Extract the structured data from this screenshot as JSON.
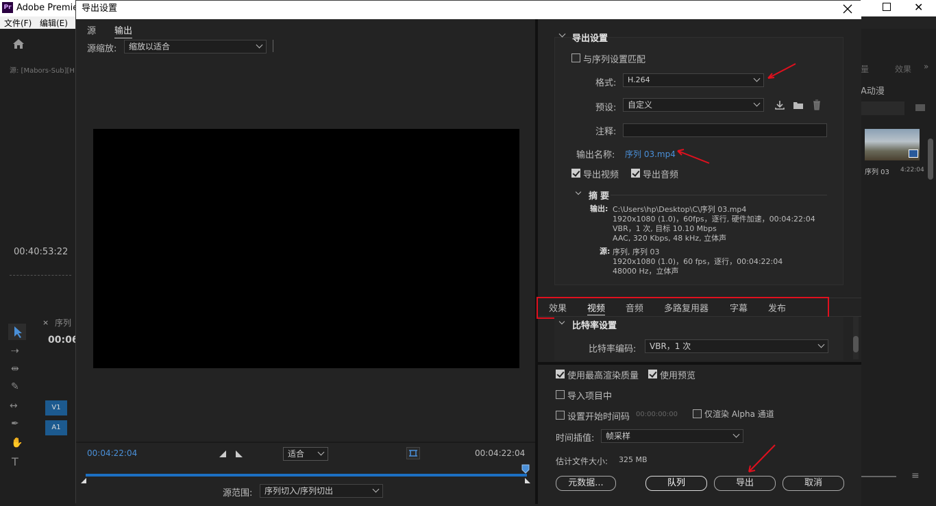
{
  "app": {
    "title": "Adobe Premier",
    "menu": [
      "文件(F)",
      "编辑(E)"
    ],
    "left": {
      "source_label": "源: [Mabors-Sub][H",
      "timecode": "00:40:53:22",
      "timeline_tab": "序列",
      "timeline_time": "00:06",
      "tracks": [
        "V1",
        "A1"
      ]
    },
    "right": {
      "tabs": [
        "量",
        "效果"
      ],
      "item_label": "A动漫",
      "thumb_name": "序列 03",
      "thumb_duration": "4:22:04"
    }
  },
  "dialog": {
    "title": "导出设置",
    "tabs": [
      "源",
      "输出"
    ],
    "source_scale_label": "源缩放:",
    "source_scale_value": "缩放以适合",
    "timecode_in": "00:04:22:04",
    "timecode_out": "00:04:22:04",
    "fit_value": "适合",
    "source_range_label": "源范围:",
    "source_range_value": "序列切入/序列切出",
    "export_settings": {
      "header": "导出设置",
      "match_sequence": "与序列设置匹配",
      "format_label": "格式:",
      "format_value": "H.264",
      "preset_label": "预设:",
      "preset_value": "自定义",
      "comment_label": "注释:",
      "comment_value": "",
      "output_name_label": "输出名称:",
      "output_name_value": "序列 03.mp4",
      "export_video": "导出视频",
      "export_audio": "导出音频",
      "summary_header": "摘要",
      "output_label": "输出:",
      "output_lines": [
        "C:\\Users\\hp\\Desktop\\C\\序列 03.mp4",
        "1920x1080 (1.0)，60fps，逐行, 硬件加速，00:04:22:04",
        "VBR，1 次, 目标 10.10 Mbps",
        "AAC, 320 Kbps, 48 kHz, 立体声"
      ],
      "source_label": "源:",
      "source_lines": [
        "序列, 序列 03",
        "1920x1080 (1.0)，60 fps，逐行，00:04:22:04",
        "48000 Hz，立体声"
      ]
    },
    "settings_tabs": [
      "效果",
      "视频",
      "音频",
      "多路复用器",
      "字幕",
      "发布"
    ],
    "active_settings_tab": "视频",
    "bitrate": {
      "header": "比特率设置",
      "encoding_label": "比特率编码:",
      "encoding_value": "VBR，1 次"
    },
    "bottom": {
      "max_render_quality": "使用最高渲染质量",
      "use_previews": "使用预览",
      "import_into_project": "导入项目中",
      "set_start_timecode": "设置开始时间码",
      "start_timecode_value": "00:00:00:00",
      "render_alpha_only": "仅渲染 Alpha 通道",
      "time_interpolation_label": "时间插值:",
      "time_interpolation_value": "帧采样",
      "estimated_size_label": "估计文件大小:",
      "estimated_size_value": "325 MB",
      "metadata_button": "元数据...",
      "queue_button": "队列",
      "export_button": "导出",
      "cancel_button": "取消"
    },
    "colors": {
      "accent": "#4a90d9",
      "annotation_red": "#e0101e",
      "background": "#232323"
    }
  }
}
